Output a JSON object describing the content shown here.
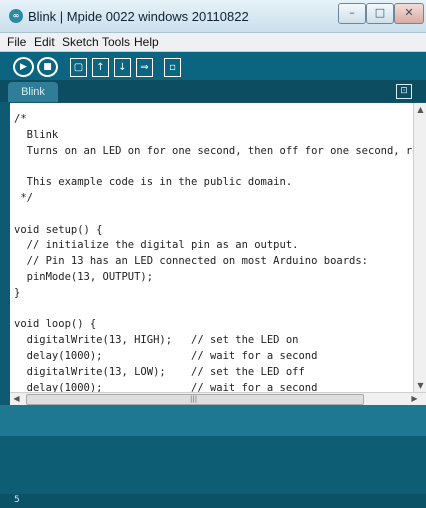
{
  "window": {
    "title": "Blink | Mpide 0022 windows 20110822",
    "app_icon": "∞",
    "controls": {
      "minimize": "–",
      "maximize": "□",
      "close": "✕"
    }
  },
  "menu": [
    "File",
    "Edit",
    "Sketch",
    "Tools",
    "Help"
  ],
  "toolbar": {
    "verify_icon": "▶",
    "stop_icon": "■",
    "new_icon": "▢",
    "open_icon": "↑",
    "save_icon": "↓",
    "upload_icon": "⇒",
    "serial_monitor_icon": "▫"
  },
  "tabs": {
    "active": "Blink",
    "menu_icon": "⊡"
  },
  "editor": {
    "code": "/*\n  Blink\n  Turns on an LED on for one second, then off for one second, repe\n\n  This example code is in the public domain.\n */\n\nvoid setup() {\n  // initialize the digital pin as an output.\n  // Pin 13 has an LED connected on most Arduino boards:\n  pinMode(13, OUTPUT);\n}\n\nvoid loop() {\n  digitalWrite(13, HIGH);   // set the LED on\n  delay(1000);              // wait for a second\n  digitalWrite(13, LOW);    // set the LED off\n  delay(1000);              // wait for a second\n}"
  },
  "scrollbars": {
    "up": "▲",
    "down": "▼",
    "left": "◀",
    "right": "▶",
    "grip": "|||"
  },
  "status": {
    "line_number": "5"
  }
}
